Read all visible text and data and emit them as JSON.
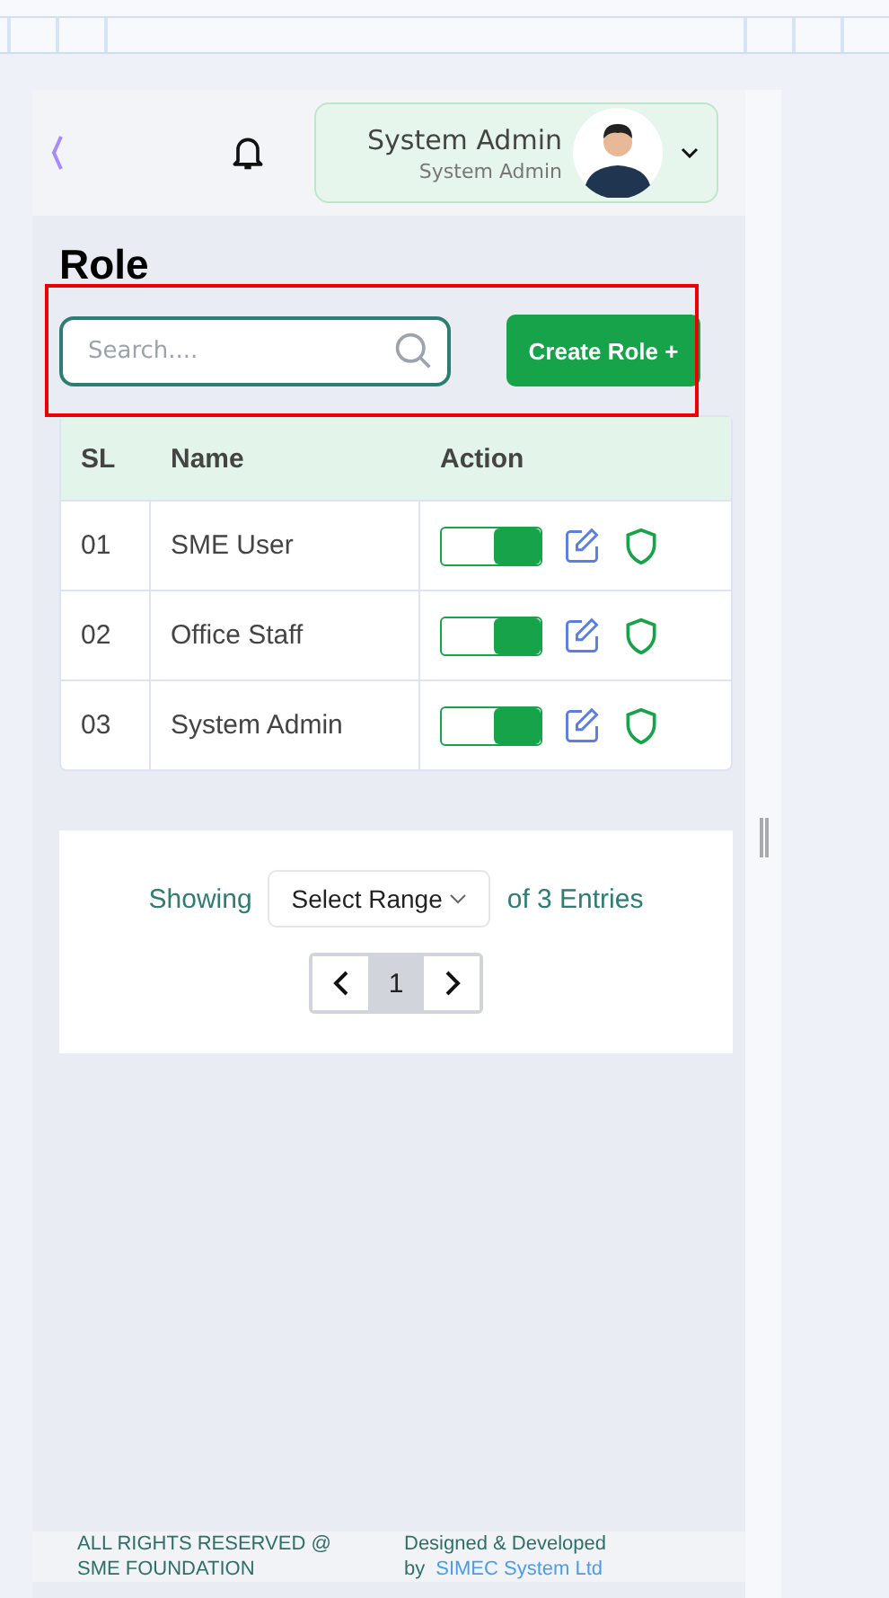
{
  "header": {
    "user_name": "System Admin",
    "user_role": "System Admin"
  },
  "page_title": "Role",
  "search": {
    "placeholder": "Search...."
  },
  "create_button": "Create Role +",
  "table": {
    "columns": [
      "SL",
      "Name",
      "Action"
    ],
    "rows": [
      {
        "sl": "01",
        "name": "SME User",
        "active": true
      },
      {
        "sl": "02",
        "name": "Office Staff",
        "active": true
      },
      {
        "sl": "03",
        "name": "System Admin",
        "active": true
      }
    ]
  },
  "pagination": {
    "showing": "Showing",
    "range_select": "Select Range",
    "entries": "of 3 Entries",
    "pages": [
      {
        "label": "1",
        "selected": true
      }
    ]
  },
  "footer": {
    "rights_line1": "ALL RIGHTS RESERVED @",
    "rights_line2": "SME FOUNDATION",
    "credit_line1": "Designed & Developed",
    "credit_by": "by",
    "credit_link": "SIMEC System Ltd"
  }
}
